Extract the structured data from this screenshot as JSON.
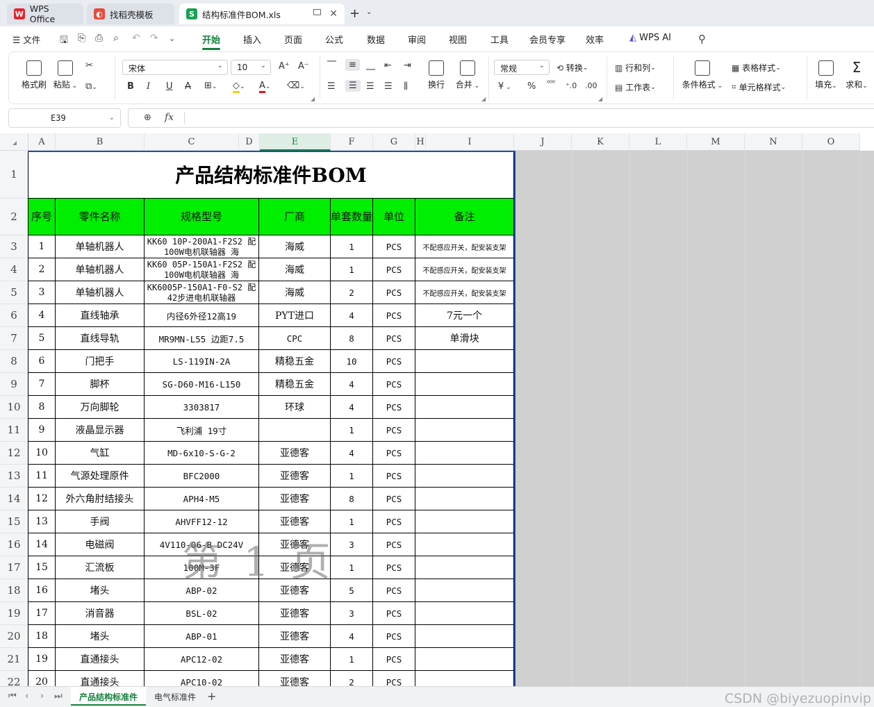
{
  "tabs": [
    {
      "label": "WPS Office",
      "icon": "wps-logo-icon"
    },
    {
      "label": "找稻壳模板",
      "icon": "docer-icon"
    },
    {
      "label": "结构标准件BOM.xls",
      "icon": "spreadsheet-icon",
      "icon_letter": "S"
    }
  ],
  "menu": {
    "file": "文件",
    "tabs": [
      "开始",
      "插入",
      "页面",
      "公式",
      "数据",
      "审阅",
      "视图",
      "工具",
      "会员专享",
      "效率",
      "WPS AI"
    ],
    "active": "开始"
  },
  "ribbon": {
    "format_painter": "格式刷",
    "paste": "粘贴",
    "font_name": "宋体",
    "font_size": "10",
    "wrap": "换行",
    "merge": "合并",
    "number_format": "常规",
    "convert": "转换",
    "rows_cols": "行和列",
    "worksheet": "工作表",
    "cond_format": "条件格式",
    "table_style": "表格样式",
    "cell_style": "单元格样式",
    "fill": "填充",
    "sum": "求和",
    "currency": "¥"
  },
  "formula": {
    "cell_ref": "E39",
    "fx": "fx",
    "value": ""
  },
  "columns": [
    "A",
    "B",
    "C",
    "D",
    "E",
    "F",
    "G",
    "H",
    "I",
    "J",
    "K",
    "L",
    "M",
    "N",
    "O"
  ],
  "selected_column": "E",
  "title": "产品结构标准件BOM",
  "headers": [
    "序号",
    "零件名称",
    "规格型号",
    "厂商",
    "单套数量",
    "单位",
    "备注"
  ],
  "rows": [
    [
      "1",
      "单轴机器人",
      "KK60 10P-200A1-F2S2 配100W电机联轴器  海",
      "海威",
      "1",
      "PCS",
      "不配感应开关，配安装支架"
    ],
    [
      "2",
      "单轴机器人",
      "KK60 05P-150A1-F2S2 配100W电机联轴器 海",
      "海威",
      "1",
      "PCS",
      "不配感应开关，配安装支架"
    ],
    [
      "3",
      "单轴机器人",
      "KK6005P-150A1-F0-S2 配42步进电机联轴器",
      "海威",
      "2",
      "PCS",
      "不配感应开关，配安装支架"
    ],
    [
      "4",
      "直线轴承",
      "内径6外径12高19",
      "PYT进口",
      "4",
      "PCS",
      "7元一个"
    ],
    [
      "5",
      "直线导轨",
      "MR9MN-L55 边距7.5",
      "CPC",
      "8",
      "PCS",
      "单滑块"
    ],
    [
      "6",
      "门把手",
      "LS-119IN-2A",
      "精稳五金",
      "10",
      "PCS",
      ""
    ],
    [
      "7",
      "脚杯",
      "SG-D60-M16-L150",
      "精稳五金",
      "4",
      "PCS",
      ""
    ],
    [
      "8",
      "万向脚轮",
      "3303817",
      "环球",
      "4",
      "PCS",
      ""
    ],
    [
      "9",
      "液晶显示器",
      "飞利浦 19寸",
      "",
      "1",
      "PCS",
      ""
    ],
    [
      "10",
      "气缸",
      "MD-6x10-S-G-2",
      "亚德客",
      "4",
      "PCS",
      ""
    ],
    [
      "11",
      "气源处理原件",
      "BFC2000",
      "亚德客",
      "1",
      "PCS",
      ""
    ],
    [
      "12",
      "外六角肘结接头",
      "APH4-M5",
      "亚德客",
      "8",
      "PCS",
      ""
    ],
    [
      "13",
      "手阀",
      "AHVFF12-12",
      "亚德客",
      "1",
      "PCS",
      ""
    ],
    [
      "14",
      "电磁阀",
      "4V110-06-B DC24V",
      "亚德客",
      "3",
      "PCS",
      ""
    ],
    [
      "15",
      "汇流板",
      "100M-3F",
      "亚德客",
      "1",
      "PCS",
      ""
    ],
    [
      "16",
      "堵头",
      "ABP-02",
      "亚德客",
      "5",
      "PCS",
      ""
    ],
    [
      "17",
      "消音器",
      "BSL-02",
      "亚德客",
      "3",
      "PCS",
      ""
    ],
    [
      "18",
      "堵头",
      "ABP-01",
      "亚德客",
      "4",
      "PCS",
      ""
    ],
    [
      "19",
      "直通接头",
      "APC12-02",
      "亚德客",
      "1",
      "PCS",
      ""
    ],
    [
      "20",
      "直通接头",
      "APC10-02",
      "亚德客",
      "2",
      "PCS",
      ""
    ]
  ],
  "row_numbers": [
    "1",
    "2",
    "3",
    "4",
    "5",
    "6",
    "7",
    "8",
    "9",
    "10",
    "11",
    "12",
    "13",
    "14",
    "15",
    "16",
    "17",
    "18",
    "19",
    "20",
    "21",
    "22"
  ],
  "watermark": "第 1 页",
  "sheets": [
    "产品结构标准件",
    "电气标准件"
  ],
  "active_sheet": "产品结构标准件",
  "footer_watermark": "CSDN @biyezuopinvip",
  "colors": {
    "accent": "#15803d",
    "header_fill": "#00ee00",
    "page_edge": "#1f4fa8"
  }
}
